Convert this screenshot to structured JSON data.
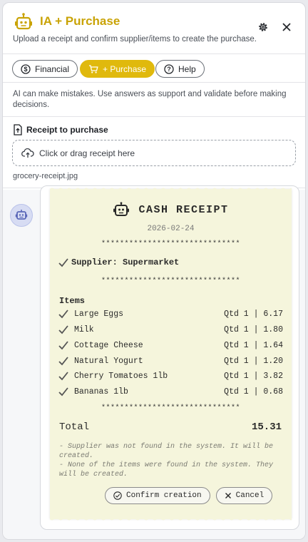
{
  "header": {
    "title": "IA + Purchase",
    "subtitle": "Upload a receipt and confirm supplier/items to create the purchase.",
    "icons": {
      "brand": "robot-icon",
      "settings": "gear-icon",
      "close": "close-icon"
    }
  },
  "tabs": [
    {
      "label": "Financial",
      "icon": "dollar-icon",
      "active": false
    },
    {
      "label": "+ Purchase",
      "icon": "cart-icon",
      "active": true
    },
    {
      "label": "Help",
      "icon": "help-icon",
      "active": false
    }
  ],
  "disclaimer": "AI can make mistakes. Use answers as support and validate before making decisions.",
  "upload": {
    "title": "Receipt to purchase",
    "dropzone_text": "Click or drag receipt here",
    "filename": "grocery-receipt.jpg"
  },
  "receipt": {
    "title": "CASH RECEIPT",
    "date": "2026-02-24",
    "separator": "******************************",
    "supplier": "Supplier: Supermarket",
    "items_label": "Items",
    "items": [
      {
        "name": "Large Eggs",
        "qty": "Qtd 1 | 6.17"
      },
      {
        "name": "Milk",
        "qty": "Qtd 1 | 1.80"
      },
      {
        "name": "Cottage Cheese",
        "qty": "Qtd 1 | 1.64"
      },
      {
        "name": "Natural Yogurt",
        "qty": "Qtd 1 | 1.20"
      },
      {
        "name": "Cherry Tomatoes 1lb",
        "qty": "Qtd 1 | 3.82"
      },
      {
        "name": "Bananas 1lb",
        "qty": "Qtd 1 | 0.68"
      }
    ],
    "total_label": "Total",
    "total_value": "15.31",
    "notes": [
      "- Supplier was not found in the system. It will be created.",
      "- None of the items were found in the system. They will be created."
    ],
    "confirm_label": "Confirm creation",
    "cancel_label": "Cancel"
  },
  "colors": {
    "accent": "#e0b90d",
    "title": "#c9a306",
    "receipt_bg": "#f5f5dc"
  }
}
